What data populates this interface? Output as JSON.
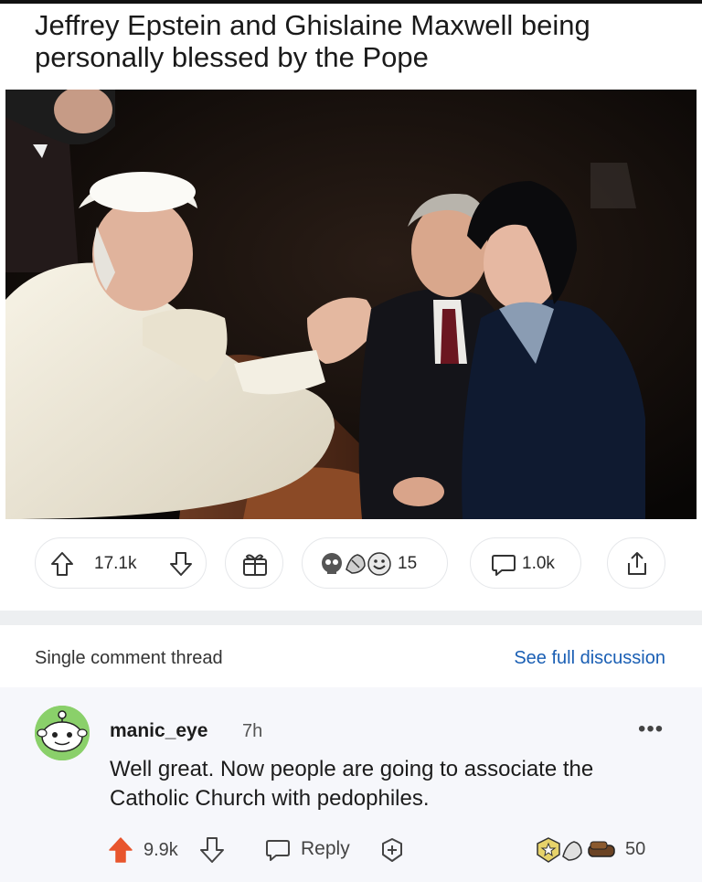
{
  "post": {
    "title": "Jeffrey Epstein and Ghislaine Maxwell being personally blessed by the Pope"
  },
  "actions": {
    "votes": "17.1k",
    "awards_count": "15",
    "comments": "1.0k"
  },
  "thread": {
    "label": "Single comment thread",
    "link": "See full discussion"
  },
  "comment": {
    "username": "manic_eye",
    "time": "7h",
    "text": "Well great. Now people are going to associate the Catholic Church with pedophiles.",
    "votes": "9.9k",
    "reply_label": "Reply",
    "awards_count": "50",
    "more_label": "•••"
  },
  "colors": {
    "upvote_active": "#e8552d",
    "link": "#1a5fb4",
    "avatar_bg": "#8ad06a"
  }
}
